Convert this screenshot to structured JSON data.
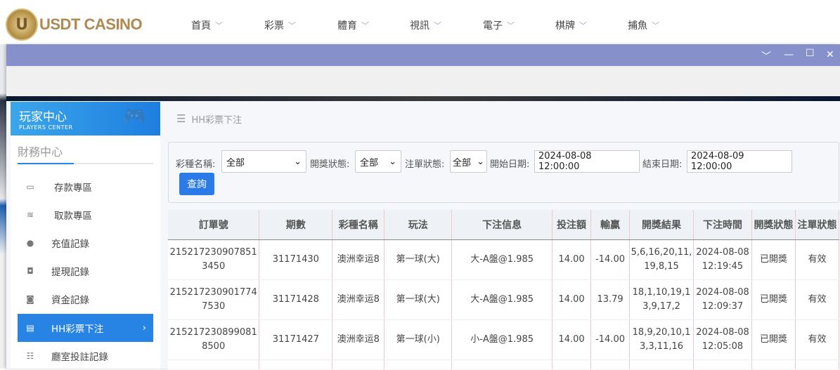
{
  "header": {
    "logo_text": "USDT CASINO",
    "logo_letter": "U",
    "nav": [
      "首頁",
      "彩票",
      "體育",
      "視訊",
      "電子",
      "棋牌",
      "捕魚"
    ]
  },
  "window": {
    "controls": [
      "chevron-down",
      "minimize",
      "maximize",
      "close"
    ]
  },
  "sidebar": {
    "title": "玩家中心",
    "subtitle": "PLAYERS CENTER",
    "section": "財務中心",
    "items": [
      {
        "label": "存款專區",
        "icon": "card-icon"
      },
      {
        "label": "取款專區",
        "icon": "hand-money-icon"
      },
      {
        "label": "充值記錄",
        "icon": "money-bag-icon"
      },
      {
        "label": "提現記錄",
        "icon": "wallet-icon"
      },
      {
        "label": "資金記錄",
        "icon": "coins-icon"
      },
      {
        "label": "HH彩票下注",
        "icon": "list-icon",
        "active": true
      },
      {
        "label": "廳室投註記錄",
        "icon": "list-bullets-icon"
      }
    ]
  },
  "breadcrumb": {
    "label": "HH彩票下注"
  },
  "filter": {
    "lottery_label": "彩種名稱:",
    "lottery_value": "全部",
    "draw_status_label": "開獎狀態:",
    "draw_status_value": "全部",
    "bet_status_label": "注單狀態:",
    "bet_status_value": "全部",
    "start_label": "開始日期:",
    "start_value": "2024-08-08 12:00:00",
    "end_label": "結束日期:",
    "end_value": "2024-08-09 12:00:00",
    "query_label": "查詢"
  },
  "table": {
    "headers": [
      "訂單號",
      "期數",
      "彩種名稱",
      "玩法",
      "下注信息",
      "投注額",
      "輸贏",
      "開獎結果",
      "下注時間",
      "開獎狀態",
      "注單狀態"
    ],
    "rows": [
      [
        "2152172309078513450",
        "31171430",
        "澳洲幸运8",
        "第一球(大)",
        "大-A盤@1.985",
        "14.00",
        "-14.00",
        "5,6,16,20,11,19,8,15",
        "2024-08-08 12:19:45",
        "已開獎",
        "有效"
      ],
      [
        "2152172309017747530",
        "31171428",
        "澳洲幸运8",
        "第一球(大)",
        "大-A盤@1.985",
        "14.00",
        "13.79",
        "18,1,10,19,13,9,17,2",
        "2024-08-08 12:09:37",
        "已開獎",
        "有效"
      ],
      [
        "2152172308990818500",
        "31171427",
        "澳洲幸运8",
        "第一球(小)",
        "小-A盤@1.985",
        "14.00",
        "-14.00",
        "18,9,20,10,13,3,11,16",
        "2024-08-08 12:05:08",
        "已開獎",
        "有效"
      ]
    ]
  },
  "colors": {
    "titlebar": "#8691cc",
    "accent": "#2784e4",
    "button": "#2a7ae8"
  }
}
